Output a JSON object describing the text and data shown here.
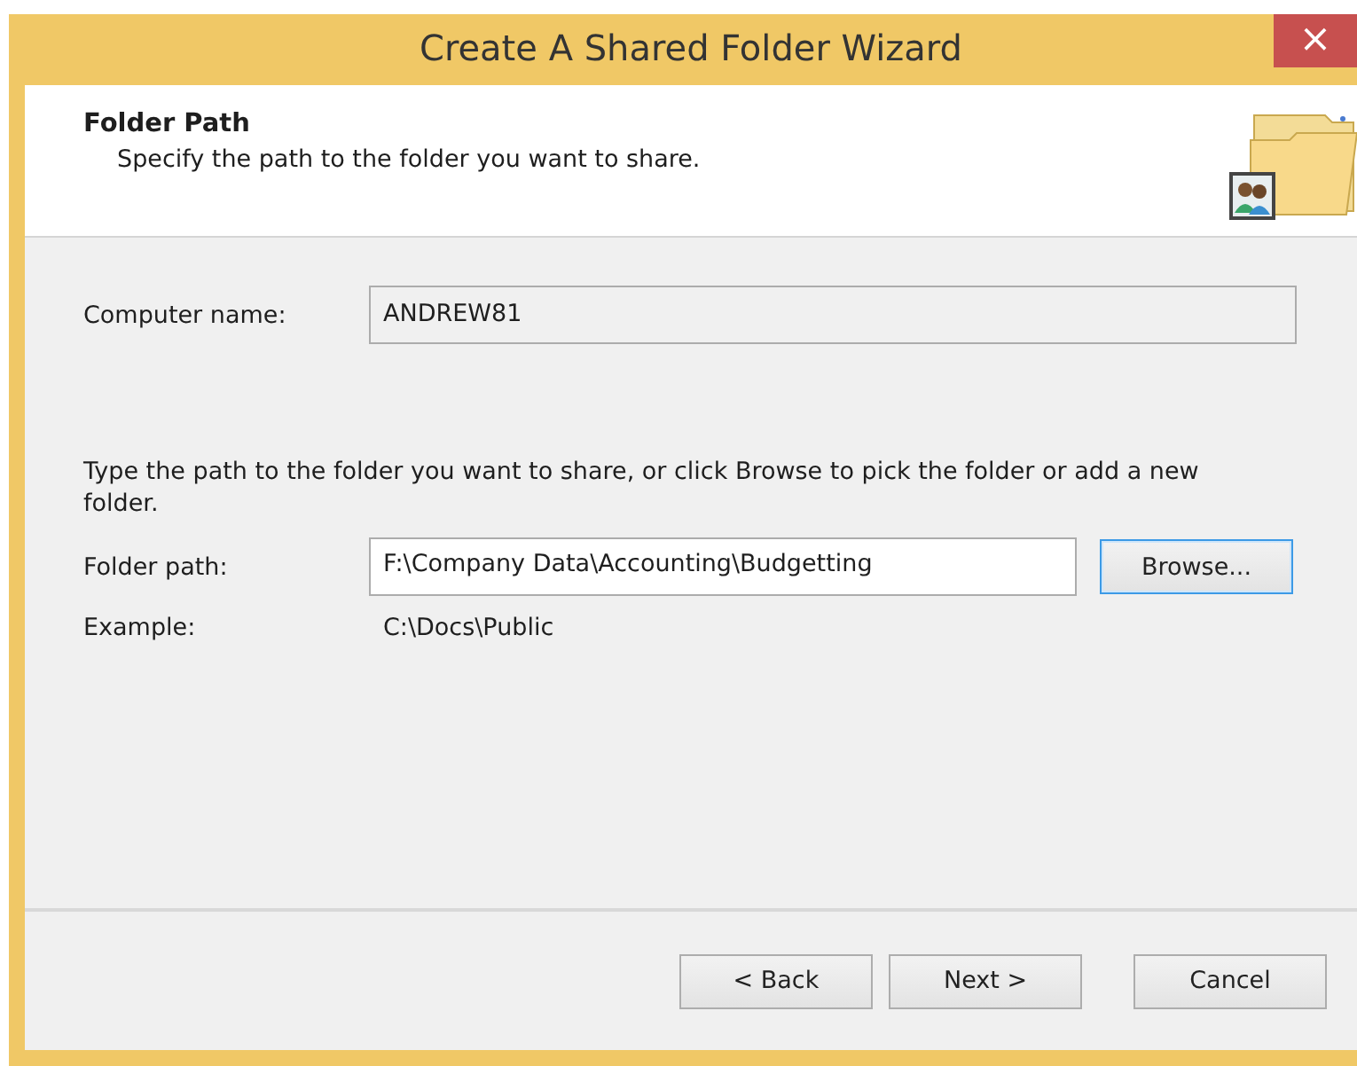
{
  "window": {
    "title": "Create A Shared Folder Wizard",
    "close": "×"
  },
  "header": {
    "title": "Folder Path",
    "subtitle": "Specify the path to the folder you want to share."
  },
  "computer_name": {
    "label": "Computer name:",
    "value": "ANDREW81",
    "disabled": true
  },
  "instructions": "Type the path to the folder you want to share, or click Browse to pick the folder or add a new folder.",
  "folder_path": {
    "label": "Folder path:",
    "value": "F:\\Company Data\\Accounting\\Budgetting",
    "disabled": false
  },
  "browse_button": {
    "label": "Browse...",
    "focused": true
  },
  "example": {
    "label": "Example:",
    "value": "C:\\Docs\\Public"
  },
  "buttons": [
    {
      "label": "< Back",
      "kind": "back",
      "focused": false
    },
    {
      "label": "Next >",
      "kind": "next",
      "focused": false
    },
    {
      "label": "Cancel",
      "kind": "cancel",
      "focused": false
    }
  ]
}
